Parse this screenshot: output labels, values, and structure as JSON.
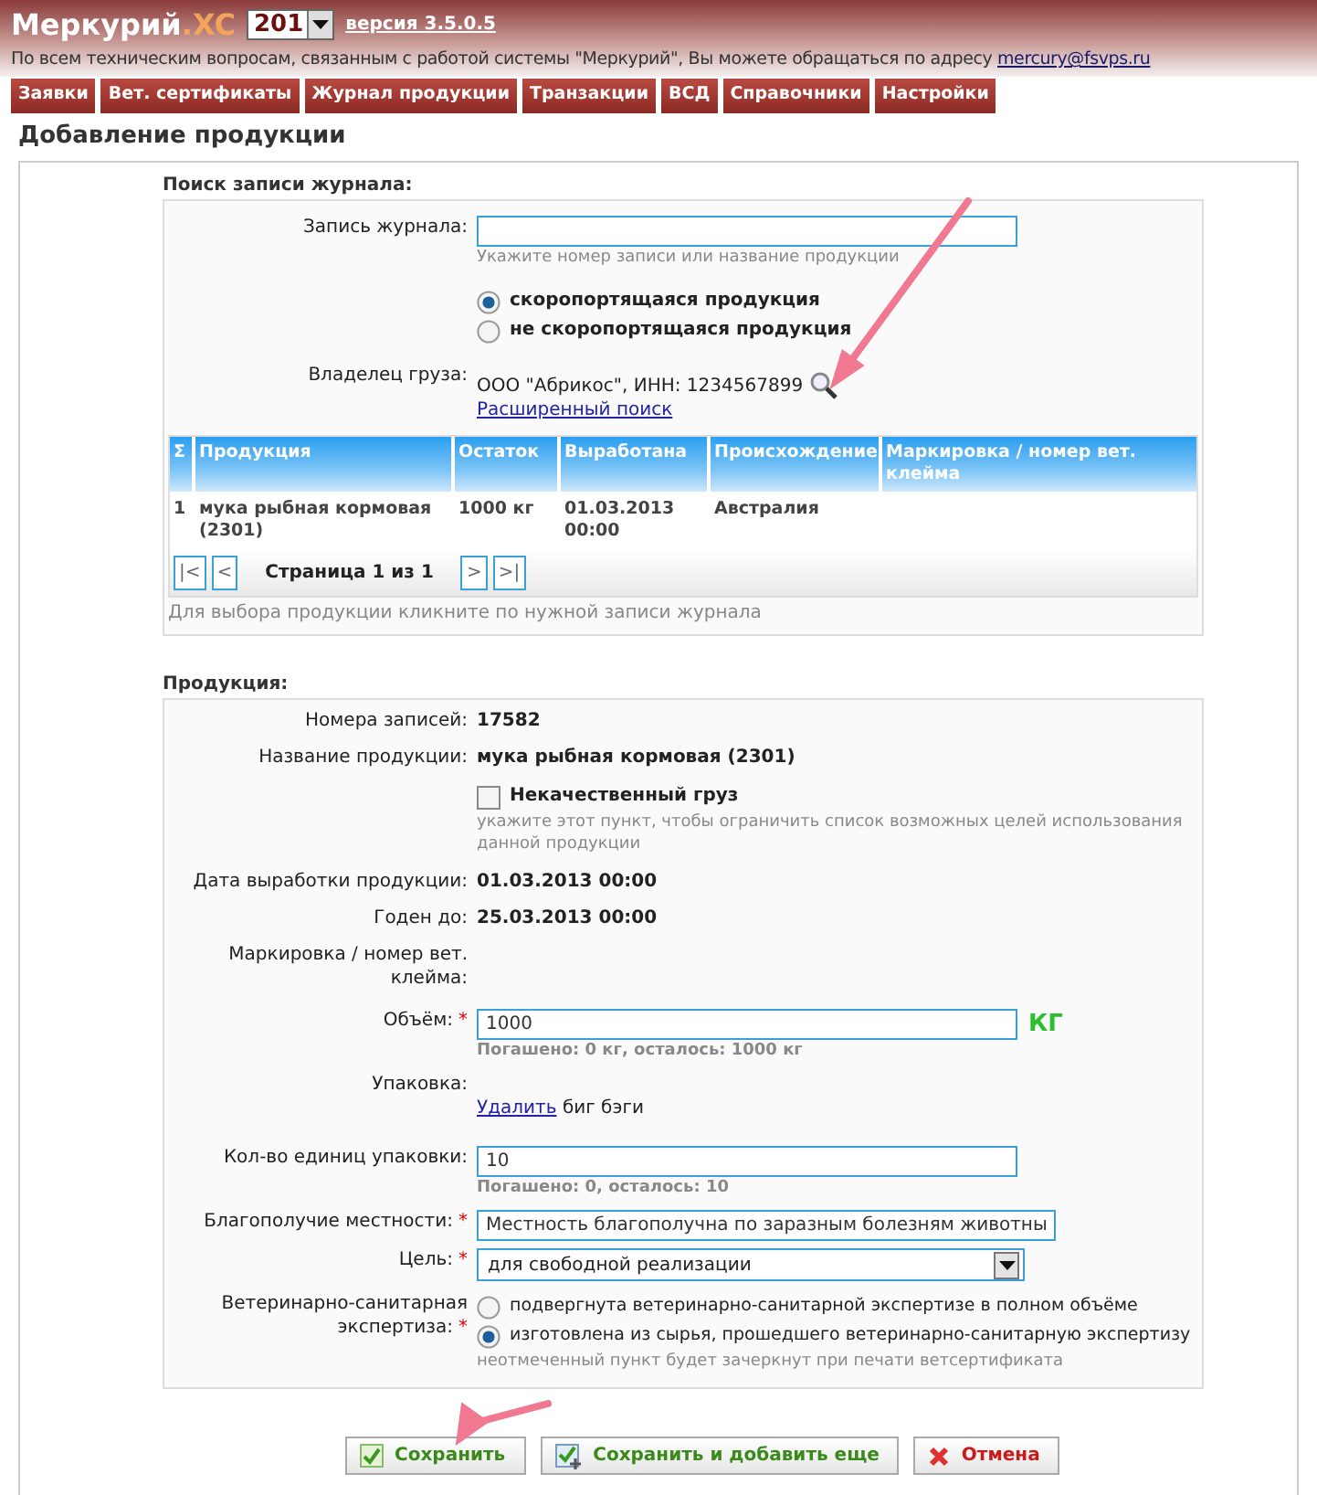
{
  "header": {
    "logo_name": "Меркурий",
    "logo_suffix": ".XC",
    "year_select": "201",
    "version_link": "версия 3.5.0.5",
    "support_text": "По всем техническим вопросам, связанным с работой системы \"Меркурий\", Вы можете обращаться по адресу",
    "support_email": "mercury@fsvps.ru"
  },
  "nav": [
    {
      "label": "Заявки",
      "selected": false
    },
    {
      "label": "Вет. сертификаты",
      "selected": false
    },
    {
      "label": "Журнал продукции",
      "selected": false
    },
    {
      "label": "Транзакции",
      "selected": false
    },
    {
      "label": "ВСД",
      "selected": false
    },
    {
      "label": "Справочники",
      "selected": false
    },
    {
      "label": "Настройки",
      "selected": false
    }
  ],
  "page_title": "Добавление продукции",
  "search_section": {
    "title": "Поиск записи журнала:",
    "journal_entry": {
      "label": "Запись журнала:",
      "hint": "Укажите номер записи или название продукции"
    },
    "perishability": [
      {
        "label": "скоропортящаяся продукция",
        "selected": true
      },
      {
        "label": "не скоропортящаяся продукция",
        "selected": false
      }
    ],
    "owner": {
      "label": "Владелец груза:",
      "value": "ООО \"Абрикос\", ИНН: 1234567899",
      "link": "Расширенный поиск"
    },
    "table": {
      "columns": [
        "Σ",
        "Продукция",
        "Остаток",
        "Выработана",
        "Происхождение",
        "Маркировка / номер вет. клейма"
      ],
      "rows": [
        {
          "cells": [
            "1",
            "мука рыбная кормовая (2301)",
            "1000 кг",
            "01.03.2013 00:00",
            "Австралия"
          ]
        }
      ]
    },
    "pager": {
      "first": "|<",
      "prev": "<",
      "page_text": "Страница 1 из 1",
      "next": ">",
      "last": ">|"
    },
    "note": "Для выбора продукции кликните по нужной записи журнала"
  },
  "product_section": {
    "title": "Продукция:",
    "rows": [
      {
        "kind": "text",
        "label": "Номера записей:",
        "value": "17582"
      },
      {
        "kind": "text",
        "label": "Название продукции:",
        "value": "мука рыбная кормовая (2301)"
      },
      {
        "kind": "checkbox",
        "checkbox_label": "Некачественный груз",
        "checked": false,
        "hint": "укажите этот пункт, чтобы ограничить список возможных целей использования данной продукции"
      },
      {
        "kind": "text",
        "label": "Дата выработки продукции:",
        "value": "01.03.2013 00:00"
      },
      {
        "kind": "text",
        "label": "Годен до:",
        "value": "25.03.2013 00:00"
      },
      {
        "kind": "text",
        "label": "Маркировка / номер вет. клейма:"
      },
      {
        "kind": "input",
        "label": "Объём:",
        "required_mark": "*",
        "value": "1000",
        "unit": "КГ",
        "hint": "Погашено: 0 кг, осталось: 1000 кг"
      },
      {
        "kind": "packaging",
        "label": "Упаковка:",
        "link": "Удалить",
        "value": "биг бэги"
      },
      {
        "kind": "input",
        "label": "Кол-во единиц упаковки:",
        "value": "10",
        "hint": "Погашено: 0, осталось: 10"
      },
      {
        "kind": "input",
        "label": "Благополучие местности:",
        "required_mark": "*",
        "value": "Местность благополучна по заразным болезням животны"
      },
      {
        "kind": "select",
        "label": "Цель:",
        "required_mark": "*",
        "value": "для свободной реализации"
      },
      {
        "kind": "radio",
        "label": "Ветеринарно-санитарная экспертиза:",
        "required_mark": "*",
        "options": [
          {
            "label": "подвергнута ветеринарно-санитарной экспертизе в полном объёме",
            "selected": false
          },
          {
            "label": "изготовлена из сырья, прошедшего ветеринарно-санитарную экспертизу",
            "selected": true
          }
        ],
        "hint": "неотмеченный пункт будет зачеркнут при печати ветсертификата"
      }
    ]
  },
  "buttons": [
    {
      "kind": "save",
      "label": "Сохранить"
    },
    {
      "kind": "save_add",
      "label": "Сохранить и добавить еще"
    },
    {
      "kind": "cancel",
      "label": "Отмена"
    }
  ]
}
